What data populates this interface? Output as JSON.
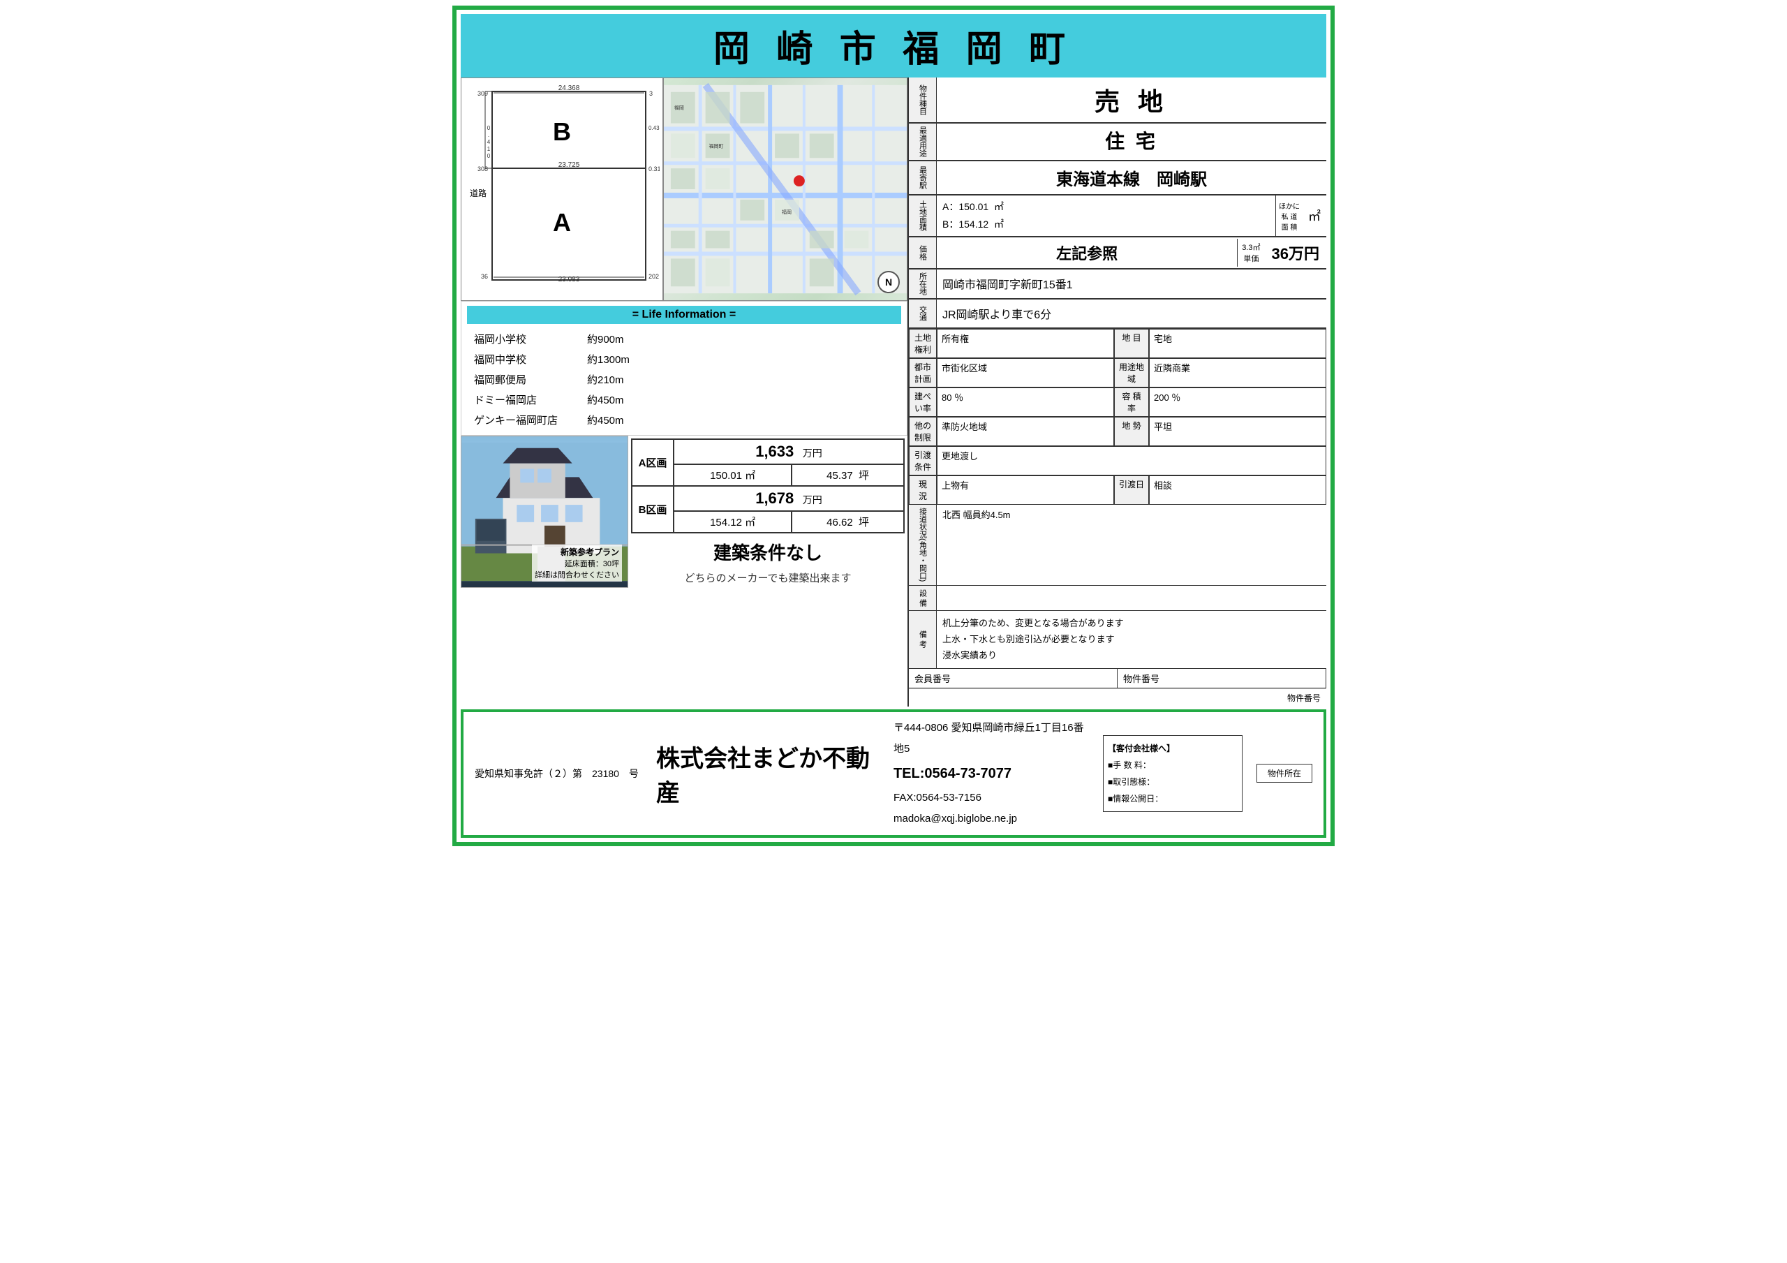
{
  "header": {
    "title": "岡 崎 市 福 岡 町"
  },
  "life_info": {
    "header": "= Life Information =",
    "items": [
      {
        "name": "福岡小学校",
        "distance": "約900m"
      },
      {
        "name": "福岡中学校",
        "distance": "約1300m"
      },
      {
        "name": "福岡郵便局",
        "distance": "約210m"
      },
      {
        "name": "ドミー福岡店",
        "distance": "約450m"
      },
      {
        "name": "ゲンキー福岡町店",
        "distance": "約450m"
      }
    ]
  },
  "price_table": {
    "a_label": "A区画",
    "a_price": "1,633",
    "a_unit": "万円",
    "a_area": "150.01",
    "a_sqm": "㎡",
    "a_tsubo": "45.37",
    "a_tsubo_unit": "坪",
    "b_label": "B区画",
    "b_price": "1,678",
    "b_unit": "万円",
    "b_area": "154.12",
    "b_sqm": "㎡",
    "b_tsubo": "46.62",
    "b_tsubo_unit": "坪",
    "no_condition": "建築条件なし",
    "no_condition_sub": "どちらのメーカーでも建築出来ます"
  },
  "house_label": {
    "title": "新築参考プラン",
    "area": "延床面積：30坪",
    "note": "詳細は問合わせください"
  },
  "property": {
    "type_label": "物件種目",
    "type_value": "売 地",
    "use_label": "最適用途",
    "use_value": "住 宅",
    "station_label": "最寄駅",
    "station_value": "東海道本線　岡崎駅",
    "land_area_label": "土地面積",
    "land_area_a": "A：150.01",
    "land_area_b": "B：154.12",
    "land_area_unit": "㎡",
    "land_area_note1": "ほかに",
    "land_area_note2": "私 道",
    "land_area_note3": "面 積",
    "land_area_extra_unit": "㎡",
    "price_label": "価格",
    "price_main": "左記参照",
    "price_unit1": "3.3㎡",
    "price_unit2": "単価",
    "price_man": "36万円",
    "address_label": "所在地",
    "address_value": "岡崎市福岡町字新町15番1",
    "transport_label": "交通",
    "transport_value": "JR岡崎駅より車で6分",
    "land_right_label": "土地権利",
    "land_right_value": "所有権",
    "land_target_label": "地 目",
    "land_target_value": "宅地",
    "city_plan_label": "都市計画",
    "city_plan_value": "市街化区域",
    "use_area_label": "用途地域",
    "use_area_value": "近隣商業",
    "coverage_label": "建ぺい率",
    "coverage_value": "80 ％",
    "floor_area_label": "容 積 率",
    "floor_area_value": "200 ％",
    "other_control_label": "他の制限",
    "other_control_value": "準防火地域",
    "topography_label": "地 勢",
    "topography_value": "平坦",
    "delivery_label": "引渡条件",
    "delivery_value": "更地渡し",
    "status_label": "現 況",
    "status_value1": "上物有",
    "status_date_label": "引渡日",
    "status_date_value": "相談",
    "contact_label": "接道状況(角地・間口)",
    "contact_value": "北西 幅員約4.5m",
    "equipment_label": "設 備",
    "equipment_value": "",
    "remarks_label": "備 考",
    "remarks_line1": "机上分筆のため、変更となる場合があります",
    "remarks_line2": "上水・下水とも別途引込が必要となります",
    "remarks_line3": "浸水実績あり",
    "member_no_label": "会員番号",
    "property_no_label": "物件番号",
    "property_no_label2": "物件番号"
  },
  "land_diagram": {
    "road_label": "道路",
    "width_top": "24.368",
    "width_mid": "23.725",
    "width_bot": "23.083",
    "height_left": "0.410",
    "height_b": "309",
    "height_a": "308",
    "height_bottom": "36",
    "label_b": "B",
    "label_a": "A",
    "right_top": "3",
    "right_num1": "0.436",
    "right_mid": "0.310",
    "right_bot": "202"
  },
  "footer": {
    "license": "愛知県知事免許（２）第　23180　号",
    "company": "株式会社まどか不動産",
    "address_zip": "〒444-0806 愛知県岡崎市緑丘1丁目16番地5",
    "tel": "TEL:0564-73-7077",
    "fax": "FAX:0564-53-7156",
    "email": "madoka@xqj.biglobe.ne.jp",
    "client_label": "【客付会社様へ】",
    "client_fee": "■手 数 料：",
    "client_deal": "■取引態様：",
    "client_date": "■情報公開日：",
    "property_location_label": "物件所在"
  }
}
